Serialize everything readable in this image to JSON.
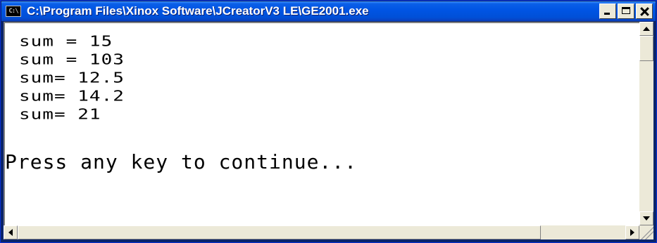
{
  "window": {
    "icon_text": "C:\\",
    "title": "C:\\Program Files\\Xinox Software\\JCreatorV3 LE\\GE2001.exe"
  },
  "console": {
    "lines": [
      "sum = 15",
      "sum = 103",
      "sum= 12.5",
      "sum= 14.2",
      "sum= 21"
    ],
    "prompt": "Press any key to continue..."
  },
  "icons": {
    "minimize": "minimize-icon",
    "maximize": "maximize-icon",
    "close": "close-icon",
    "scroll_up": "arrow-up-icon",
    "scroll_down": "arrow-down-icon",
    "scroll_left": "arrow-left-icon",
    "scroll_right": "arrow-right-icon"
  }
}
